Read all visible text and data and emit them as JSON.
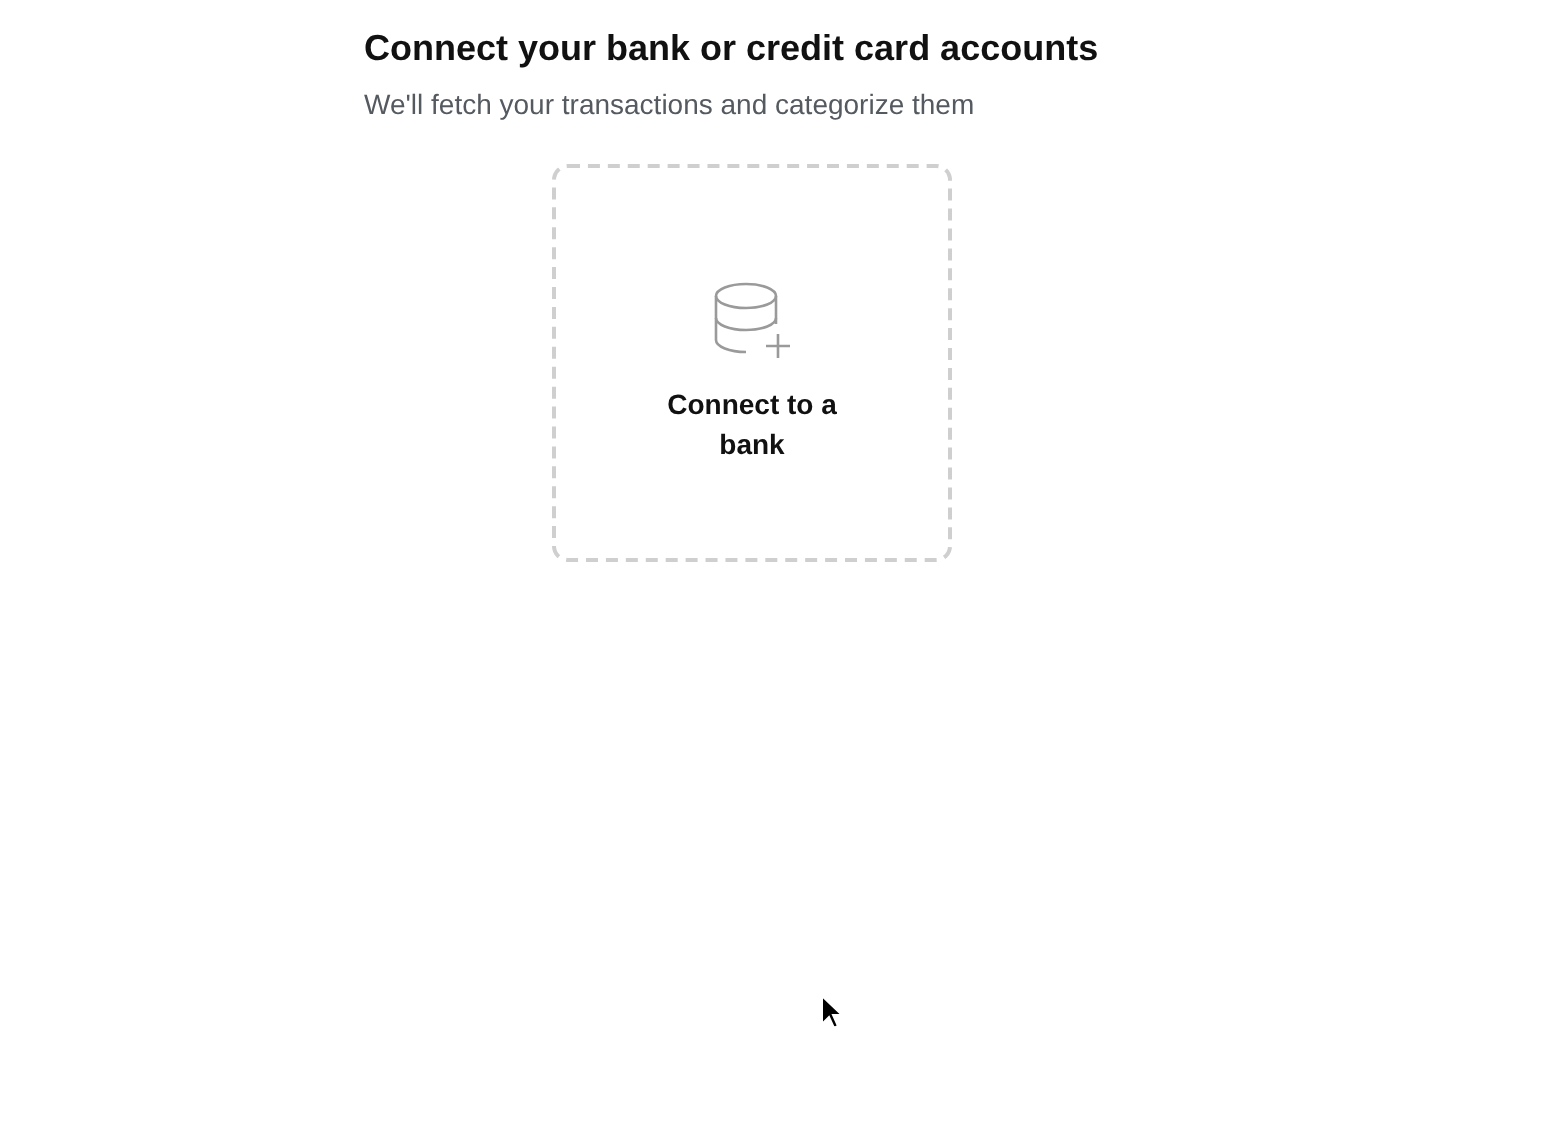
{
  "header": {
    "title": "Connect your bank or credit card accounts",
    "subtitle": "We'll fetch your transactions and categorize them"
  },
  "options": [
    {
      "kind": "bank",
      "label": "Connect to a bank"
    }
  ]
}
